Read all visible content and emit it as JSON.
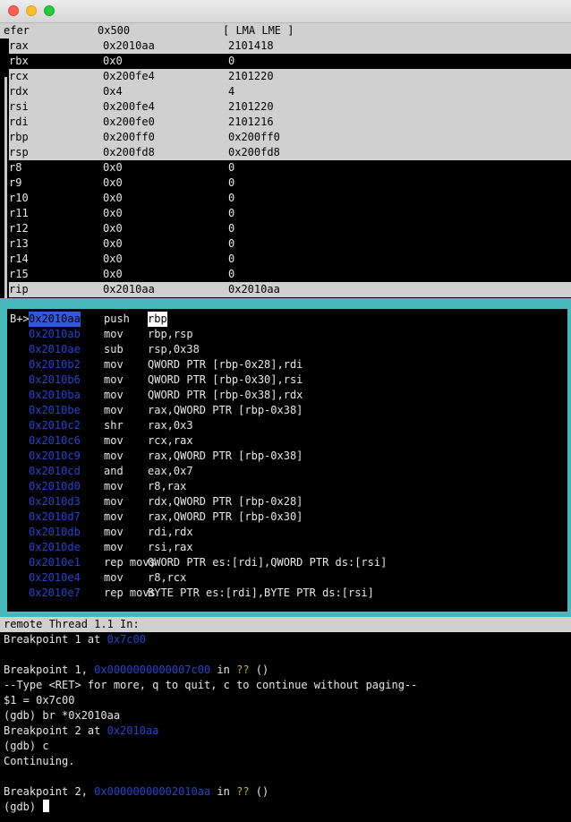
{
  "registers": [
    {
      "name": "efer",
      "hex": "0x500",
      "natural": "[ LMA LME ]"
    },
    {
      "name": "rax",
      "hex": "0x2010aa",
      "natural": "2101418"
    },
    {
      "name": "rbx",
      "hex": "0x0",
      "natural": "0"
    },
    {
      "name": "rcx",
      "hex": "0x200fe4",
      "natural": "2101220"
    },
    {
      "name": "rdx",
      "hex": "0x4",
      "natural": "4"
    },
    {
      "name": "rsi",
      "hex": "0x200fe4",
      "natural": "2101220"
    },
    {
      "name": "rdi",
      "hex": "0x200fe0",
      "natural": "2101216"
    },
    {
      "name": "rbp",
      "hex": "0x200ff0",
      "natural": "0x200ff0"
    },
    {
      "name": "rsp",
      "hex": "0x200fd8",
      "natural": "0x200fd8"
    },
    {
      "name": "r8",
      "hex": "0x0",
      "natural": "0"
    },
    {
      "name": "r9",
      "hex": "0x0",
      "natural": "0"
    },
    {
      "name": "r10",
      "hex": "0x0",
      "natural": "0"
    },
    {
      "name": "r11",
      "hex": "0x0",
      "natural": "0"
    },
    {
      "name": "r12",
      "hex": "0x0",
      "natural": "0"
    },
    {
      "name": "r13",
      "hex": "0x0",
      "natural": "0"
    },
    {
      "name": "r14",
      "hex": "0x0",
      "natural": "0"
    },
    {
      "name": "r15",
      "hex": "0x0",
      "natural": "0"
    },
    {
      "name": "rip",
      "hex": "0x2010aa",
      "natural": "0x2010aa"
    }
  ],
  "disassembly": [
    {
      "marker": "B+>",
      "addr": "0x2010aa",
      "op": "push",
      "args": "rbp"
    },
    {
      "marker": "",
      "addr": "0x2010ab",
      "op": "mov",
      "args": "rbp,rsp"
    },
    {
      "marker": "",
      "addr": "0x2010ae",
      "op": "sub",
      "args": "rsp,0x38"
    },
    {
      "marker": "",
      "addr": "0x2010b2",
      "op": "mov",
      "args": "QWORD PTR [rbp-0x28],rdi"
    },
    {
      "marker": "",
      "addr": "0x2010b6",
      "op": "mov",
      "args": "QWORD PTR [rbp-0x30],rsi"
    },
    {
      "marker": "",
      "addr": "0x2010ba",
      "op": "mov",
      "args": "QWORD PTR [rbp-0x38],rdx"
    },
    {
      "marker": "",
      "addr": "0x2010be",
      "op": "mov",
      "args": "rax,QWORD PTR [rbp-0x38]"
    },
    {
      "marker": "",
      "addr": "0x2010c2",
      "op": "shr",
      "args": "rax,0x3"
    },
    {
      "marker": "",
      "addr": "0x2010c6",
      "op": "mov",
      "args": "rcx,rax"
    },
    {
      "marker": "",
      "addr": "0x2010c9",
      "op": "mov",
      "args": "rax,QWORD PTR [rbp-0x38]"
    },
    {
      "marker": "",
      "addr": "0x2010cd",
      "op": "and",
      "args": "eax,0x7"
    },
    {
      "marker": "",
      "addr": "0x2010d0",
      "op": "mov",
      "args": "r8,rax"
    },
    {
      "marker": "",
      "addr": "0x2010d3",
      "op": "mov",
      "args": "rdx,QWORD PTR [rbp-0x28]"
    },
    {
      "marker": "",
      "addr": "0x2010d7",
      "op": "mov",
      "args": "rax,QWORD PTR [rbp-0x30]"
    },
    {
      "marker": "",
      "addr": "0x2010db",
      "op": "mov",
      "args": "rdi,rdx"
    },
    {
      "marker": "",
      "addr": "0x2010de",
      "op": "mov",
      "args": "rsi,rax"
    },
    {
      "marker": "",
      "addr": "0x2010e1",
      "op": "rep movs",
      "args": "QWORD PTR es:[rdi],QWORD PTR ds:[rsi]"
    },
    {
      "marker": "",
      "addr": "0x2010e4",
      "op": "mov",
      "args": "r8,rcx"
    },
    {
      "marker": "",
      "addr": "0x2010e7",
      "op": "rep movs",
      "args": "BYTE PTR es:[rdi],BYTE PTR ds:[rsi]"
    }
  ],
  "status_bar": "remote Thread 1.1 In:",
  "console": {
    "l1_text": "Breakpoint 1 at ",
    "l1_addr": "0x7c00",
    "l3_text": "Breakpoint 1, ",
    "l3_addr": "0x0000000000007c00",
    "l3_in": " in ",
    "l3_fn": "??",
    "l3_paren": " ()",
    "l4": "--Type <RET> for more, q to quit, c to continue without paging--",
    "l5": "$1 = 0x7c00",
    "l6": "(gdb) br *0x2010aa",
    "l7_text": "Breakpoint 2 at ",
    "l7_addr": "0x2010aa",
    "l8": "(gdb) c",
    "l9": "Continuing.",
    "l11_text": "Breakpoint 2, ",
    "l11_addr": "0x00000000002010aa",
    "l11_in": " in ",
    "l11_fn": "??",
    "l11_paren": " ()",
    "prompt": "(gdb) "
  },
  "colors": {
    "teal_border": "#47b7bb",
    "address_blue": "#2a43c8",
    "function_yellow": "#c9b32a",
    "highlight_gray": "#d0d0d0"
  }
}
